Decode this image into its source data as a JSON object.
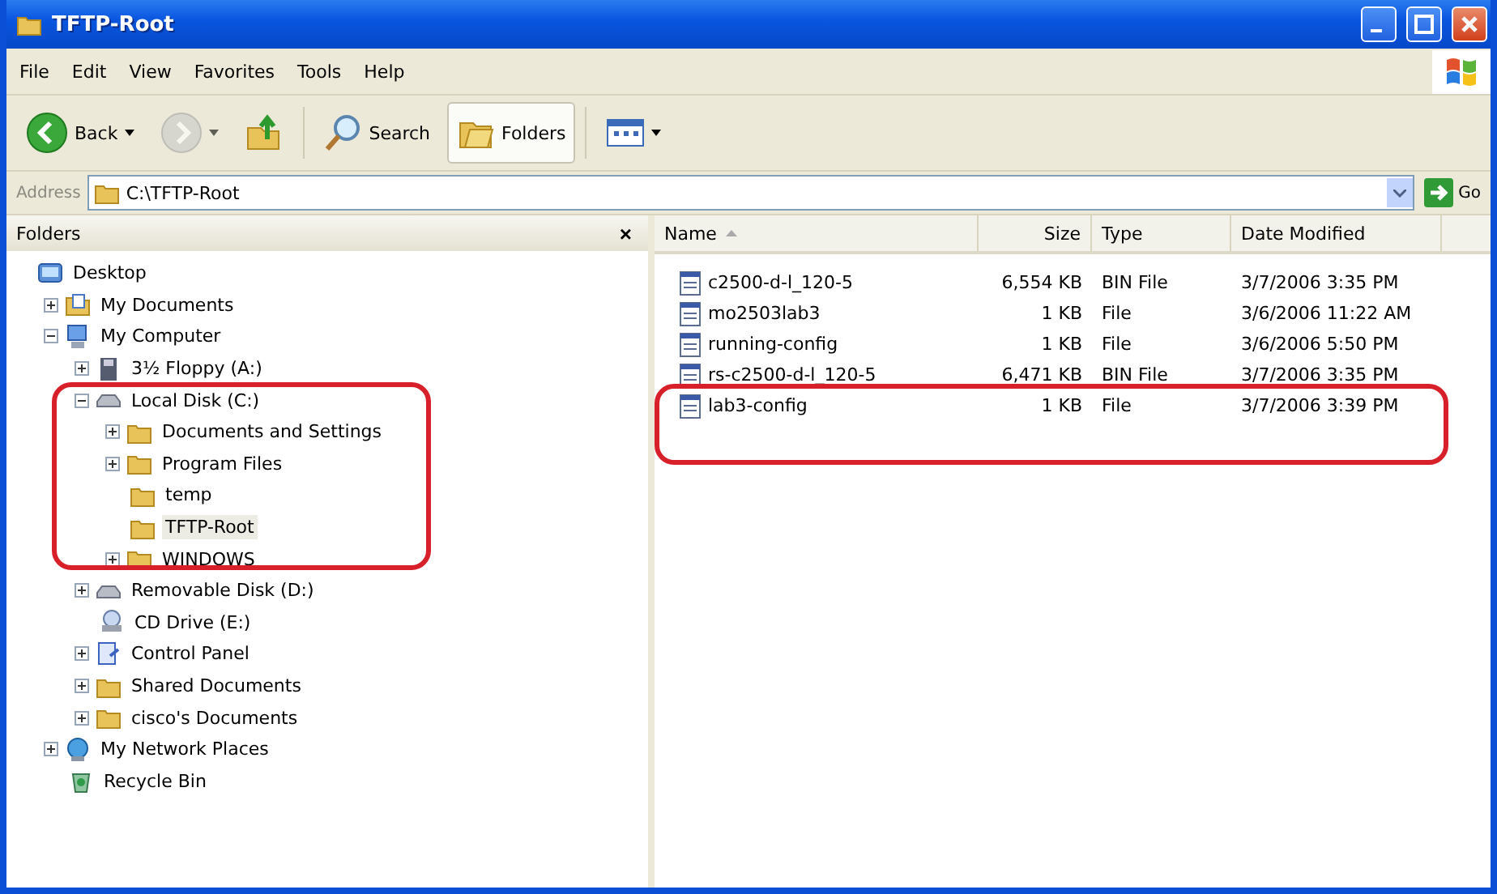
{
  "window": {
    "title": "TFTP-Root"
  },
  "menu": [
    "File",
    "Edit",
    "View",
    "Favorites",
    "Tools",
    "Help"
  ],
  "toolbar": [
    {
      "kind": "back",
      "label": "Back",
      "dropdown": true,
      "disabled": false,
      "selected": false
    },
    {
      "kind": "forward",
      "dropdown": true,
      "disabled": true,
      "selected": false
    },
    {
      "kind": "up",
      "disabled": false,
      "selected": false
    },
    {
      "kind": "search",
      "label": "Search",
      "disabled": false,
      "selected": false
    },
    {
      "kind": "folders",
      "label": "Folders",
      "disabled": false,
      "selected": true
    },
    {
      "kind": "views",
      "dropdown": true,
      "disabled": false,
      "selected": false
    }
  ],
  "address": {
    "label": "Address",
    "value": "C:\\TFTP-Root",
    "go": "Go"
  },
  "folders_pane": {
    "title": "Folders",
    "close": "×",
    "tree": [
      {
        "label": "Desktop",
        "kind": "desktop",
        "selected": false,
        "children": [
          {
            "label": "My Documents",
            "kind": "documents",
            "expanded": false,
            "selected": false
          },
          {
            "label": "My Computer",
            "kind": "computer",
            "expanded": true,
            "selected": false,
            "children": [
              {
                "label": "3½ Floppy (A:)",
                "kind": "floppy",
                "expanded": false,
                "selected": false
              },
              {
                "label": "Local Disk (C:)",
                "kind": "disk",
                "expanded": true,
                "selected": false,
                "children": [
                  {
                    "label": "Documents and Settings",
                    "kind": "folder",
                    "expanded": false,
                    "selected": false
                  },
                  {
                    "label": "Program Files",
                    "kind": "folder",
                    "expanded": false,
                    "selected": false
                  },
                  {
                    "label": "temp",
                    "kind": "folder",
                    "selected": false
                  },
                  {
                    "label": "TFTP-Root",
                    "kind": "folder",
                    "selected": true
                  },
                  {
                    "label": "WINDOWS",
                    "kind": "folder",
                    "expanded": false,
                    "selected": false
                  }
                ]
              },
              {
                "label": "Removable Disk (D:)",
                "kind": "disk",
                "expanded": false,
                "selected": false
              },
              {
                "label": "CD Drive (E:)",
                "kind": "cd",
                "selected": false
              },
              {
                "label": "Control Panel",
                "kind": "control-panel",
                "expanded": false,
                "selected": false
              },
              {
                "label": "Shared Documents",
                "kind": "folder",
                "expanded": false,
                "selected": false
              },
              {
                "label": "cisco's Documents",
                "kind": "folder",
                "expanded": false,
                "selected": false
              }
            ]
          },
          {
            "label": "My Network Places",
            "kind": "network",
            "expanded": false,
            "selected": false
          },
          {
            "label": "Recycle Bin",
            "kind": "recycle",
            "selected": false
          }
        ]
      }
    ]
  },
  "file_list": {
    "columns": [
      {
        "label": "Name",
        "sorted": true
      },
      {
        "label": "Size",
        "sorted": false
      },
      {
        "label": "Type",
        "sorted": false
      },
      {
        "label": "Date Modified",
        "sorted": false
      }
    ],
    "rows": [
      {
        "name": "c2500-d-l_120-5",
        "size": "6,554 KB",
        "type": "BIN File",
        "date": "3/7/2006 3:35 PM",
        "selected": false
      },
      {
        "name": "mo2503lab3",
        "size": "1 KB",
        "type": "File",
        "date": "3/6/2006 11:22 AM",
        "selected": false
      },
      {
        "name": "running-config",
        "size": "1 KB",
        "type": "File",
        "date": "3/6/2006 5:50 PM",
        "selected": false
      },
      {
        "name": "rs-c2500-d-l_120-5",
        "size": "6,471 KB",
        "type": "BIN File",
        "date": "3/7/2006 3:35 PM",
        "selected": false
      },
      {
        "name": "lab3-config",
        "size": "1 KB",
        "type": "File",
        "date": "3/7/2006 3:39 PM",
        "selected": false
      }
    ]
  }
}
